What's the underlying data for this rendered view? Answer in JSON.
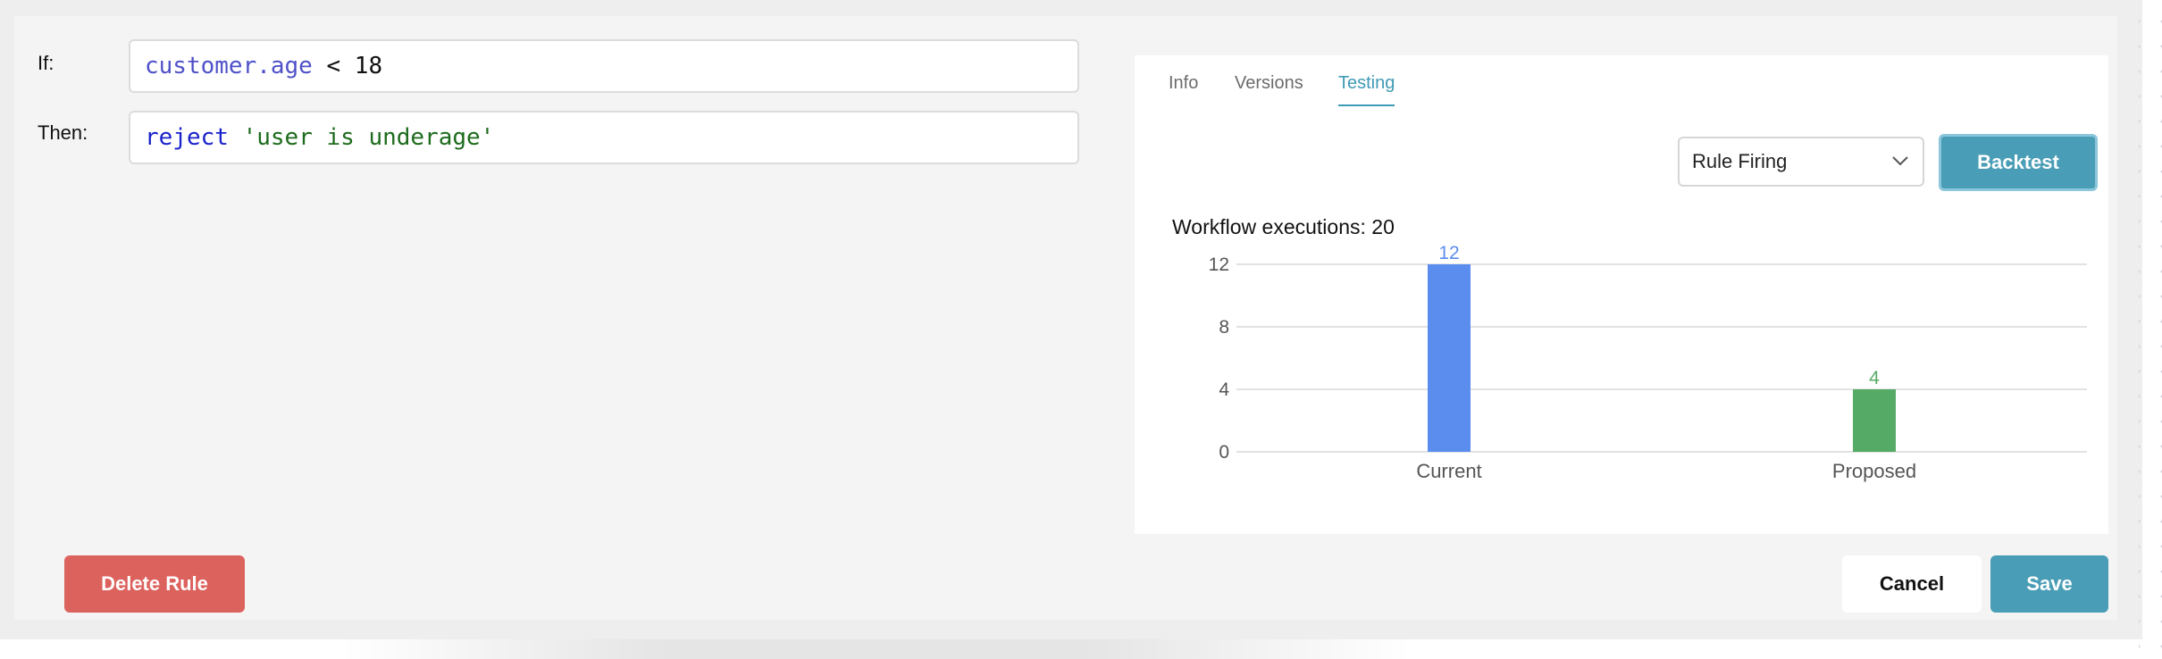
{
  "rule": {
    "if_label": "If:",
    "then_label": "Then:",
    "if_tokens": {
      "field": "customer.age",
      "operator": " < 18"
    },
    "then_tokens": {
      "keyword": "reject",
      "string": " 'user is underage'"
    }
  },
  "tabs": [
    {
      "label": "Info",
      "active": false
    },
    {
      "label": "Versions",
      "active": false
    },
    {
      "label": "Testing",
      "active": true
    }
  ],
  "testing": {
    "metric_select": {
      "value": "Rule Firing"
    },
    "backtest_label": "Backtest",
    "executions_text": "Workflow executions: 20"
  },
  "chart_data": {
    "type": "bar",
    "categories": [
      "Current",
      "Proposed"
    ],
    "values": [
      12,
      4
    ],
    "ylim": [
      0,
      12
    ],
    "yticks": [
      0,
      4,
      8,
      12
    ],
    "colors": [
      "#5b8def",
      "#55aa66"
    ],
    "data_labels": true,
    "grid": true
  },
  "actions": {
    "delete_label": "Delete Rule",
    "cancel_label": "Cancel",
    "save_label": "Save"
  },
  "colors": {
    "accent": "#4a9db6",
    "danger": "#dc625e"
  }
}
